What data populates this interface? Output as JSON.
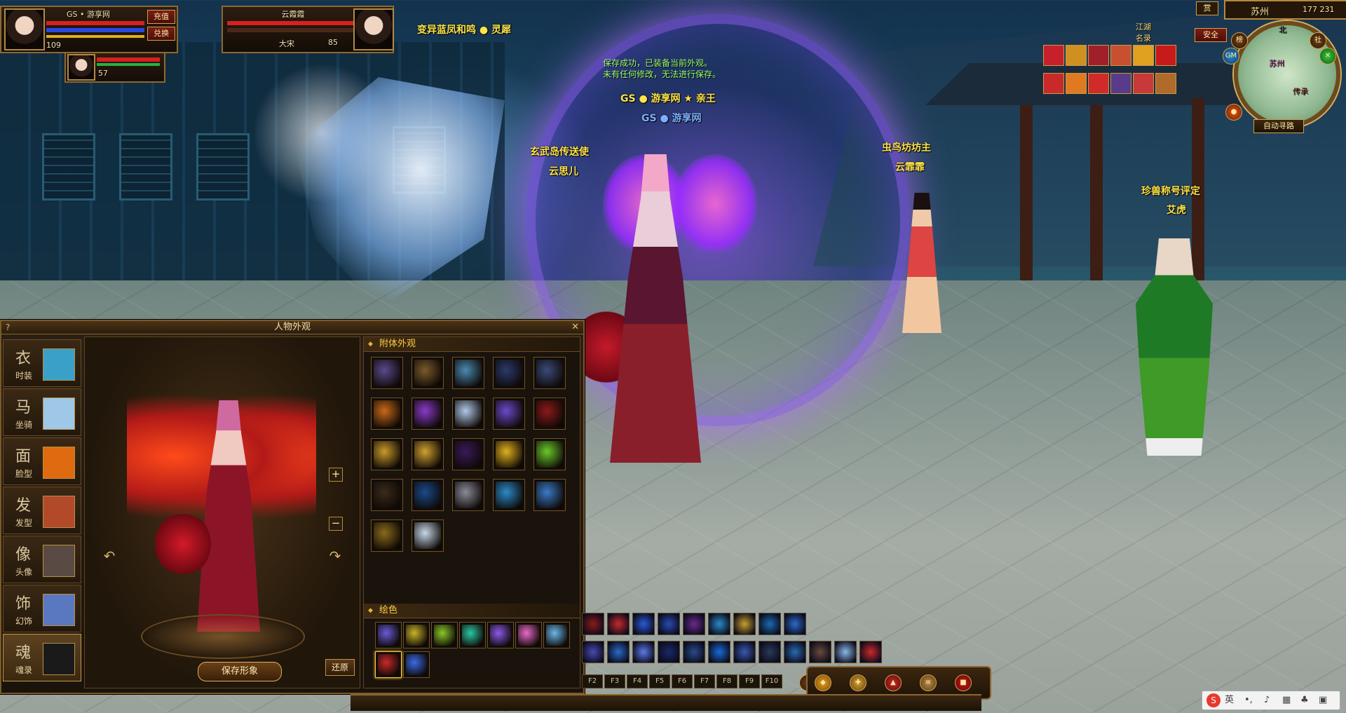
{
  "player": {
    "name": "GS • 游享网",
    "level": "109",
    "recharge_label": "充值",
    "exchange_label": "兑换"
  },
  "pet": {
    "level": "57"
  },
  "target": {
    "name": "云霞霞",
    "faction": "大宋",
    "level": "85"
  },
  "map": {
    "location": "苏州",
    "coords": "177  231",
    "direction": "北",
    "safe_label": "安全",
    "rank_label": "榜",
    "social_label": "社",
    "gm_label": "GM",
    "badge_label": "赏",
    "autopath_label": "自动寻路",
    "minimap_labels": [
      "苏州",
      "传承"
    ]
  },
  "top_banner": {
    "guild_label": "江湖\n名录"
  },
  "scene": {
    "top_text": "变异蓝凤和鸣 ● 灵犀",
    "message_lines": [
      "保存成功，已装备当前外观。",
      "未有任何修改，无法进行保存。"
    ],
    "main_char_title": "GS ● 游享网 ★ 亲王",
    "main_char_name": "GS ● 游享网",
    "npcs": [
      {
        "title": "玄武岛传送使",
        "name": "云思儿"
      },
      {
        "title": "虫鸟坊坊主",
        "name": "云霏霏"
      },
      {
        "title": "珍兽称号评定",
        "name": "艾虎"
      }
    ]
  },
  "panel": {
    "title": "人物外观",
    "help_icon": "?",
    "close_icon": "✕",
    "tabs": [
      {
        "label": "时装",
        "glyph": "衣",
        "color": "#3aa0c8"
      },
      {
        "label": "坐骑",
        "glyph": "马",
        "color": "#9fc8e8"
      },
      {
        "label": "脸型",
        "glyph": "面",
        "color": "#e06a10"
      },
      {
        "label": "发型",
        "glyph": "发",
        "color": "#b24a2a"
      },
      {
        "label": "头像",
        "glyph": "像",
        "color": "#5a4a44"
      },
      {
        "label": "幻饰",
        "glyph": "饰",
        "color": "#5a78c0"
      },
      {
        "label": "魂录",
        "glyph": "魂",
        "color": "#1a1a1a"
      }
    ],
    "attach_section": "附体外观",
    "dye_section": "绘色",
    "zoom_in": "+",
    "zoom_out": "−",
    "rotate_left": "↶",
    "rotate_right": "↷",
    "save_label": "保存形象",
    "restore_label": "还原",
    "attach_slots": [
      "#5a4a8c",
      "#7a5a2a",
      "#4a8ab0",
      "#2a3a6a",
      "#3a4a7a",
      "#c86a18",
      "#8a3ac8",
      "#b0c8e8",
      "#6a4ac8",
      "#8a1a1a",
      "#c89a2a",
      "#d0a030",
      "#3a1a5a",
      "#e0b020",
      "#6ac82a",
      "#3a2a1a",
      "#1a4a8a",
      "#8a8a9a",
      "#2a8ac8",
      "#3a7ac8",
      "#8a6a1a",
      "#c8d8e8"
    ],
    "dye_slots": [
      "#6a5ad8",
      "#c8b42a",
      "#8ac82a",
      "#2ac8a0",
      "#8a5ae8",
      "#e86ac8",
      "#6ab8e8",
      "#c82a2a",
      "#3a6ae8"
    ]
  },
  "skillbar": {
    "row1": [
      "#8a1a1a",
      "#c82a2a",
      "#2a5ad8",
      "#2a4ab0",
      "#6a2a8a",
      "#2a8ac8",
      "#c8a02a",
      "#1a6ab0",
      "#2a6ac8"
    ],
    "row2": [
      "#4a4ab0",
      "#2a6ac8",
      "#5a7ae8",
      "#1a2a6a",
      "#2a4a8a",
      "#1a6ad8",
      "#3a5ab0",
      "#2a3a5a",
      "#2a6ab0",
      "#6a4a3a",
      "#8ab8e8",
      "#c82a2a"
    ],
    "fkeys": [
      "F2",
      "F3",
      "F4",
      "F5",
      "F6",
      "F7",
      "F8",
      "F9",
      "F10"
    ],
    "page": "1"
  },
  "ime": {
    "label": "英"
  },
  "colors": {
    "gold": "#ffcc40",
    "frame": "#8a6a35",
    "npc_title": "#ffe44a"
  }
}
